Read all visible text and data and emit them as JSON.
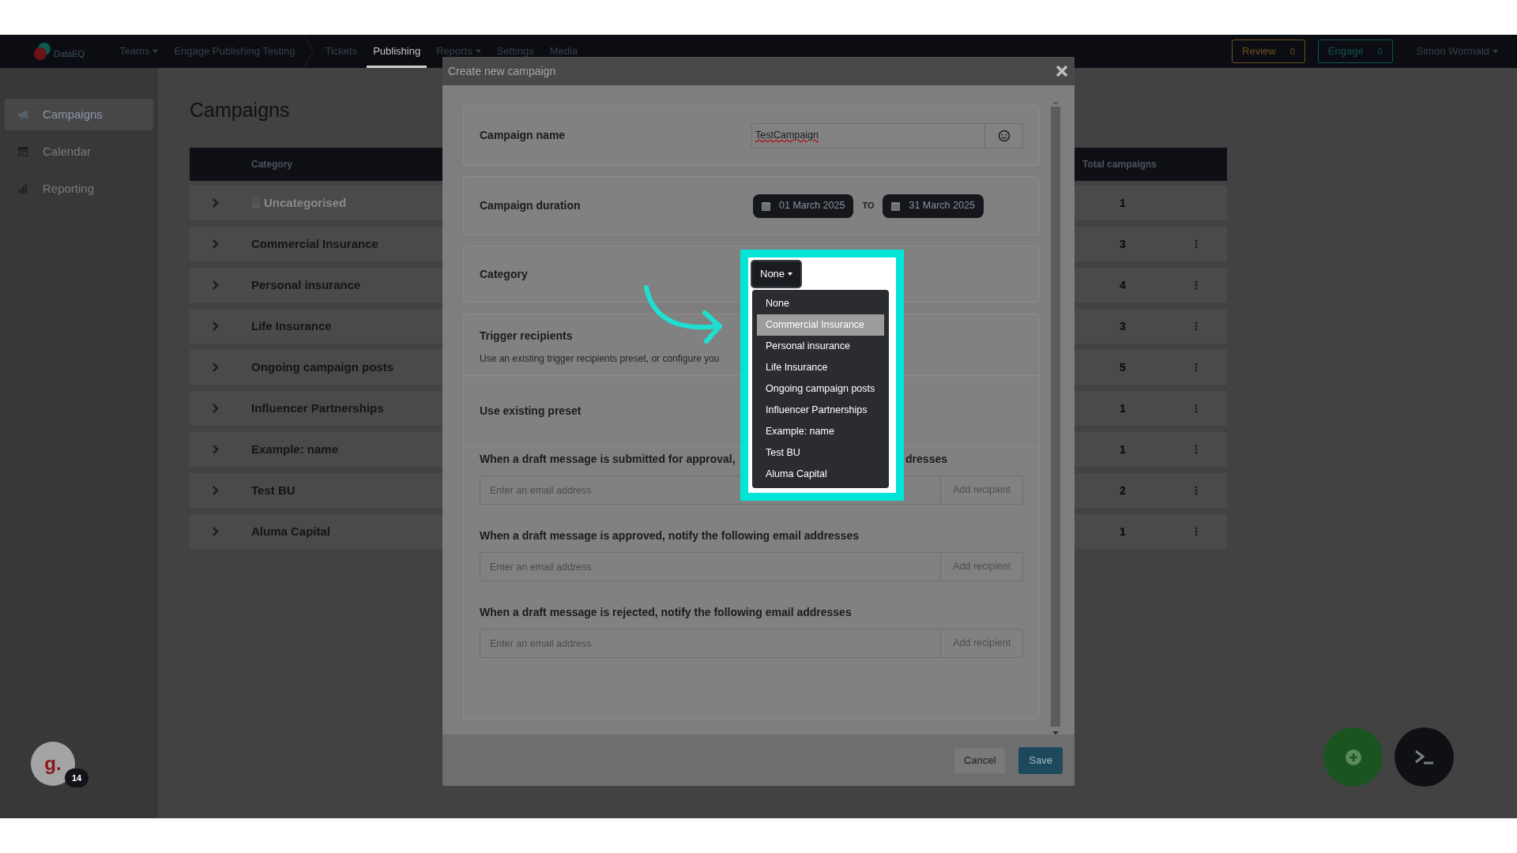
{
  "nav": {
    "logo": "DataEQ",
    "items": [
      {
        "label": "Teams",
        "kind": "dropdown",
        "selected": false
      },
      {
        "label": "Engage Publishing Testing",
        "kind": "breadcrumb",
        "selected": false
      },
      {
        "label": "Tickets",
        "kind": "link",
        "selected": false
      },
      {
        "label": "Publishing",
        "kind": "link",
        "selected": true
      },
      {
        "label": "Reports",
        "kind": "dropdown",
        "selected": false
      },
      {
        "label": "Settings",
        "kind": "link",
        "selected": false
      },
      {
        "label": "Media",
        "kind": "link",
        "selected": false
      }
    ],
    "counters": [
      {
        "label": "Review",
        "count": "0",
        "color": "#6e5020"
      },
      {
        "label": "Engage",
        "count": "0",
        "color": "#0f5552"
      }
    ],
    "user": "Simon Wormald"
  },
  "sidebar": {
    "items": [
      {
        "label": "Campaigns",
        "kind": "megaphone",
        "selected": true
      },
      {
        "label": "Calendar",
        "kind": "calendar",
        "selected": false
      },
      {
        "label": "Reporting",
        "kind": "bars",
        "selected": false
      }
    ]
  },
  "page": {
    "title": "Campaigns",
    "table": {
      "columns": [
        "Category",
        "Total campaigns"
      ],
      "rows": [
        {
          "category": "Uncategorised",
          "total": "1",
          "locked": true
        },
        {
          "category": "Commercial Insurance",
          "total": "3",
          "locked": false
        },
        {
          "category": "Personal insurance",
          "total": "4",
          "locked": false
        },
        {
          "category": "Life Insurance",
          "total": "3",
          "locked": false
        },
        {
          "category": "Ongoing campaign posts",
          "total": "5",
          "locked": false
        },
        {
          "category": "Influencer Partnerships",
          "total": "1",
          "locked": false
        },
        {
          "category": "Example: name",
          "total": "1",
          "locked": false
        },
        {
          "category": "Test BU",
          "total": "2",
          "locked": false
        },
        {
          "category": "Aluma Capital",
          "total": "1",
          "locked": false
        }
      ]
    }
  },
  "modal": {
    "title": "Create new campaign",
    "fields": [
      {
        "label": "Campaign name",
        "kind": "text",
        "value": "TestCampaign"
      },
      {
        "label": "Campaign duration",
        "kind": "daterange",
        "from": "01 March 2025",
        "separator": "TO",
        "to": "31 March 2025"
      },
      {
        "label": "Category",
        "kind": "select",
        "value": "None",
        "expanded": true,
        "options": [
          {
            "label": "None",
            "highlighted": false
          },
          {
            "label": "Commercial Insurance",
            "highlighted": true
          },
          {
            "label": "Personal insurance",
            "highlighted": false
          },
          {
            "label": "Life Insurance",
            "highlighted": false
          },
          {
            "label": "Ongoing campaign posts",
            "highlighted": false
          },
          {
            "label": "Influencer Partnerships",
            "highlighted": false
          },
          {
            "label": "Example: name",
            "highlighted": false
          },
          {
            "label": "Test BU",
            "highlighted": false
          },
          {
            "label": "Aluma Capital",
            "highlighted": false
          }
        ]
      }
    ],
    "trigger": {
      "title": "Trigger recipients",
      "description": "Use an existing trigger recipients preset, or configure you",
      "preset_label": "Use existing preset",
      "groups": [
        {
          "label_parts": [
            "When a draft message is submitted for approval,",
            "dresses"
          ],
          "placeholder": "Enter an email address",
          "button": "Add recipient"
        },
        {
          "label_parts": [
            "When a draft message is approved, notify the following email addresses"
          ],
          "placeholder": "Enter an email address",
          "button": "Add recipient"
        },
        {
          "label_parts": [
            "When a draft message is rejected, notify the following email addresses"
          ],
          "placeholder": "Enter an email address",
          "button": "Add recipient"
        }
      ]
    },
    "buttons": [
      {
        "label": "Cancel",
        "kind": "secondary"
      },
      {
        "label": "Save",
        "kind": "primary"
      }
    ]
  },
  "chat": {
    "logo": "g.",
    "badge": "14"
  }
}
